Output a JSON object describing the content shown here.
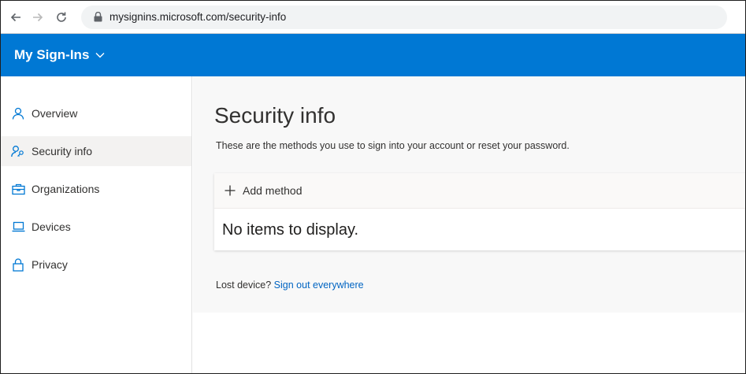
{
  "browser": {
    "url": "mysignins.microsoft.com/security-info",
    "icons": {
      "back": "arrow-left-icon",
      "forward": "arrow-right-icon",
      "reload": "reload-icon",
      "lock": "lock-icon"
    }
  },
  "header": {
    "title": "My Sign-Ins",
    "background": "#0078d4",
    "chevron_icon": "chevron-down-icon"
  },
  "sidebar": {
    "items": [
      {
        "label": "Overview",
        "icon": "person-icon",
        "active": false
      },
      {
        "label": "Security info",
        "icon": "person-key-icon",
        "active": true
      },
      {
        "label": "Organizations",
        "icon": "briefcase-icon",
        "active": false
      },
      {
        "label": "Devices",
        "icon": "laptop-icon",
        "active": false
      },
      {
        "label": "Privacy",
        "icon": "lock-icon",
        "active": false
      }
    ]
  },
  "main": {
    "title": "Security info",
    "description": "These are the methods you use to sign into your account or reset your password.",
    "add_method_label": "Add method",
    "empty_message": "No items to display.",
    "lost_device_text": "Lost device?",
    "sign_out_link": "Sign out everywhere",
    "colors": {
      "accent": "#0078d4",
      "link": "#0064c2"
    }
  }
}
